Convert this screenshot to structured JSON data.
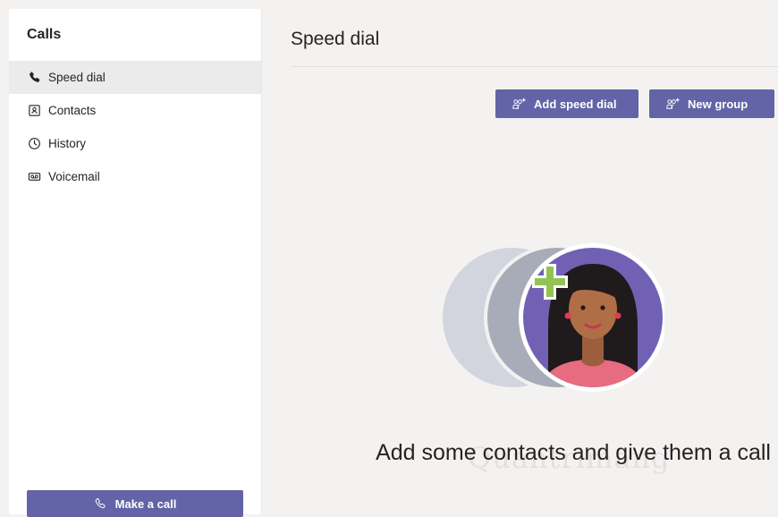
{
  "sidebar": {
    "title": "Calls",
    "items": [
      {
        "label": "Speed dial",
        "icon": "phone-icon",
        "active": true
      },
      {
        "label": "Contacts",
        "icon": "contacts-icon",
        "active": false
      },
      {
        "label": "History",
        "icon": "clock-icon",
        "active": false
      },
      {
        "label": "Voicemail",
        "icon": "voicemail-icon",
        "active": false
      }
    ],
    "make_call_label": "Make a call"
  },
  "main": {
    "title": "Speed dial",
    "add_speed_dial_label": "Add speed dial",
    "new_group_label": "New group",
    "empty_message": "Add some contacts and give them a call",
    "watermark": "Quantrimang"
  },
  "colors": {
    "accent": "#6264a7",
    "background": "#f3f2f1",
    "sidebar_bg": "#ffffff",
    "active_item": "#ebebeb",
    "text": "#252423"
  }
}
